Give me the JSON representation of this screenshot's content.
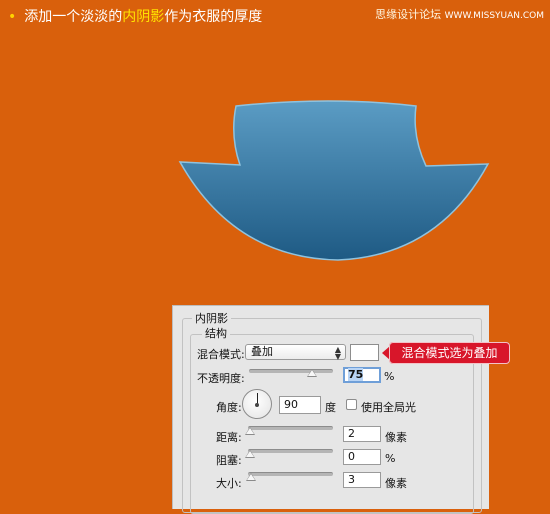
{
  "instruction": {
    "before": "添加一个淡淡的",
    "highlight": "内阴影",
    "after": "作为衣服的厚度"
  },
  "watermark": {
    "text": "思缘设计论坛",
    "url": "WWW.MISSYUAN.COM"
  },
  "colors": {
    "background": "#d9600c",
    "shape_top": "#5b9cc4",
    "shape_bottom": "#1e5a84",
    "callout": "#d8162a",
    "highlight_text": "#ffe100"
  },
  "dialog": {
    "title": "内阴影",
    "section": "结构",
    "blend_mode_label": "混合模式:",
    "blend_mode_value": "叠加",
    "opacity_label": "不透明度:",
    "opacity_value": "75",
    "opacity_unit": "%",
    "opacity_level": 0.75,
    "angle_label": "角度:",
    "angle_value": "90",
    "angle_unit": "度",
    "global_light_label": "使用全局光",
    "global_light_checked": false,
    "distance_label": "距离:",
    "distance_value": "2",
    "distance_unit": "像素",
    "choke_label": "阻塞:",
    "choke_value": "0",
    "choke_unit": "%",
    "size_label": "大小:",
    "size_value": "3",
    "size_unit": "像素"
  },
  "callout": {
    "text": "混合模式选为叠加"
  }
}
